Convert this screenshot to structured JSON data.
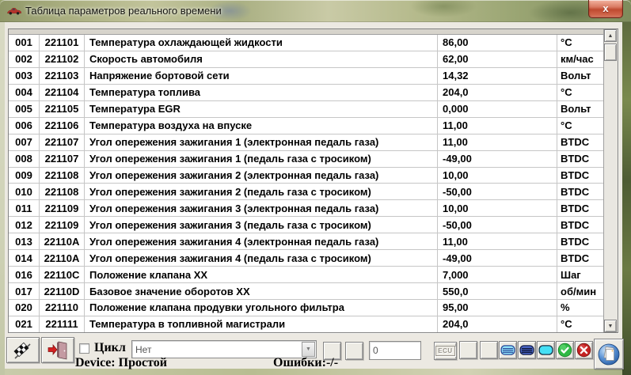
{
  "window": {
    "title": "Таблица параметров реального времени",
    "close_glyph": "x"
  },
  "table": {
    "rows": [
      {
        "num": "001",
        "code": "221101",
        "name": "Температура охлаждающей жидкости",
        "value": "86,00",
        "unit": "°C"
      },
      {
        "num": "002",
        "code": "221102",
        "name": "Скорость автомобиля",
        "value": "62,00",
        "unit": "км/час"
      },
      {
        "num": "003",
        "code": "221103",
        "name": "Напряжение бортовой сети",
        "value": "14,32",
        "unit": "Вольт"
      },
      {
        "num": "004",
        "code": "221104",
        "name": "Температура топлива",
        "value": "204,0",
        "unit": "°C"
      },
      {
        "num": "005",
        "code": "221105",
        "name": "Температура EGR",
        "value": "0,000",
        "unit": "Вольт"
      },
      {
        "num": "006",
        "code": "221106",
        "name": "Температура воздуха на впуске",
        "value": "11,00",
        "unit": "°C"
      },
      {
        "num": "007",
        "code": "221107",
        "name": "Угол опережения зажигания 1 (электронная педаль газа)",
        "value": "11,00",
        "unit": "BTDC"
      },
      {
        "num": "008",
        "code": "221107",
        "name": "Угол опережения зажигания 1 (педаль газа с тросиком)",
        "value": "-49,00",
        "unit": "BTDC"
      },
      {
        "num": "009",
        "code": "221108",
        "name": "Угол опережения зажигания 2 (электронная педаль газа)",
        "value": "10,00",
        "unit": "BTDC"
      },
      {
        "num": "010",
        "code": "221108",
        "name": "Угол опережения зажигания 2 (педаль газа с тросиком)",
        "value": "-50,00",
        "unit": "BTDC"
      },
      {
        "num": "011",
        "code": "221109",
        "name": "Угол опережения зажигания 3 (электронная педаль газа)",
        "value": "10,00",
        "unit": "BTDC"
      },
      {
        "num": "012",
        "code": "221109",
        "name": "Угол опережения зажигания 3 (педаль газа с тросиком)",
        "value": "-50,00",
        "unit": "BTDC"
      },
      {
        "num": "013",
        "code": "22110A",
        "name": "Угол опережения зажигания 4 (электронная педаль газа)",
        "value": "11,00",
        "unit": "BTDC"
      },
      {
        "num": "014",
        "code": "22110A",
        "name": "Угол опережения зажигания 4 (педаль газа с тросиком)",
        "value": "-49,00",
        "unit": "BTDC"
      },
      {
        "num": "016",
        "code": "22110C",
        "name": "Положение клапана ХХ",
        "value": "7,000",
        "unit": "Шаг"
      },
      {
        "num": "017",
        "code": "22110D",
        "name": "Базовое значение оборотов ХХ",
        "value": "550,0",
        "unit": "об/мин"
      },
      {
        "num": "020",
        "code": "221110",
        "name": "Положение клапана продувки угольного фильтра",
        "value": "95,00",
        "unit": "%"
      },
      {
        "num": "021",
        "code": "221111",
        "name": "Температура в топливной магистрали",
        "value": "204,0",
        "unit": "°C"
      }
    ]
  },
  "toolbar": {
    "cycle_label": "Цикл",
    "combo_value": "Нет",
    "counter_value": "0",
    "ecu_label": "ECU",
    "device_label": "Device: Простой",
    "errors_label": "Ошибки:-/-"
  },
  "icons": {
    "scroll_up": "▲",
    "scroll_down": "▼",
    "combo_arrow": "▼"
  },
  "colors": {
    "titlebar_glass": "#b5ba8c",
    "client_bg": "#ece9e2",
    "close_button_red": "#bf4a30",
    "ok_green": "#2fb845",
    "error_red": "#c42222",
    "list_icon_cyan": "#8fe0f8",
    "list_icon_navy": "#4a66c8"
  }
}
